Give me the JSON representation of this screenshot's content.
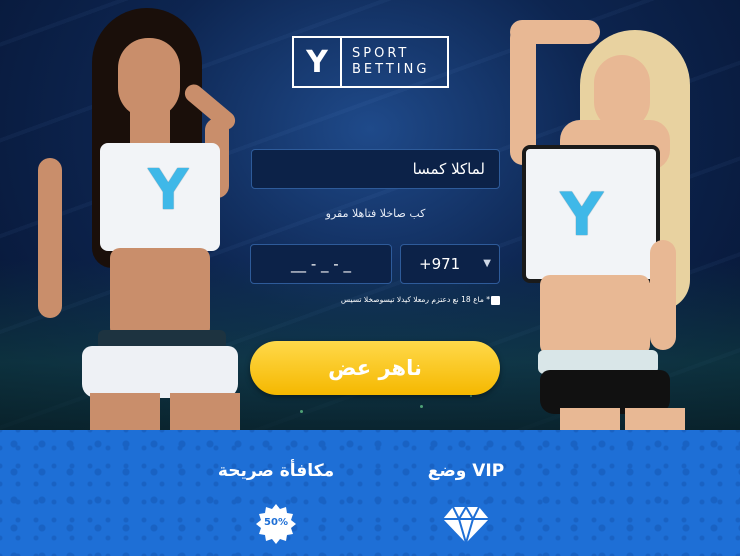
{
  "brand": {
    "mark": "Y",
    "line1": "SPORT",
    "line2": "BETTING"
  },
  "form": {
    "name_value": "لماكلا كمسا",
    "hint": "كب صاخلا فتاهلا مقرو",
    "phone_value": "__ - _ - _",
    "country_code": "+971",
    "age_text": "ماع 18 نع دعتزم رمعلا كيدلا تيسوصخلا تسيس *",
    "cta_label": "ناهر عض"
  },
  "features": {
    "bonus_title": "مكافأة صريحة",
    "bonus_badge": "50%",
    "vip_title": "وضع VIP"
  },
  "colors": {
    "accent": "#f5b800",
    "band": "#1e6fd6",
    "input_bg": "#0c2248"
  }
}
